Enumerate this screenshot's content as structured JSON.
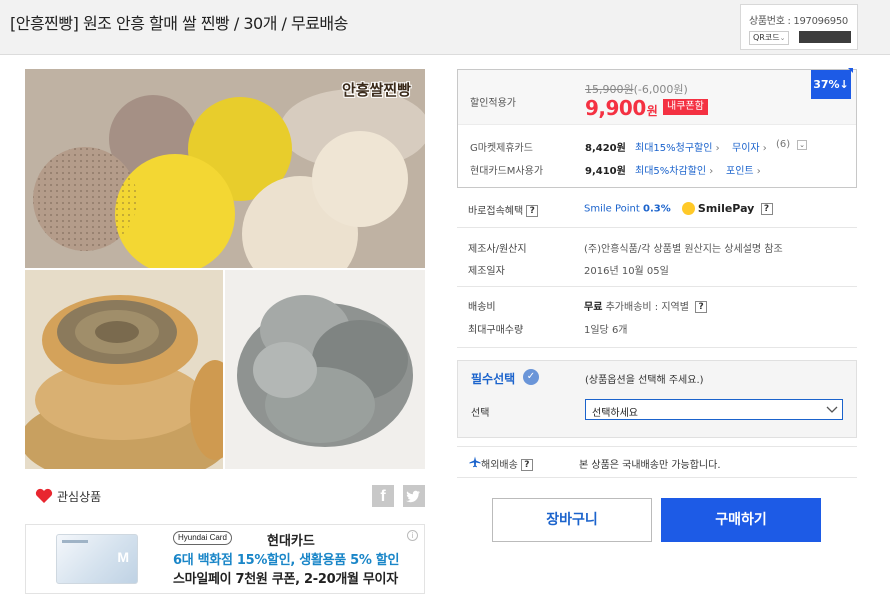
{
  "header": {
    "title": "[안흥찐빵] 원조 안흥 할매 쌀 찐빵 / 30개 / 무료배송",
    "product_no_label": "상품번호 : 197096950",
    "qr_label": "QR코드"
  },
  "gallery": {
    "image_caption": "안흥쌀찐빵"
  },
  "actions_left": {
    "wish_label": "관심상품",
    "facebook_glyph": "f"
  },
  "banner": {
    "card_brand_logo": "Hyundai Card",
    "card_name": "현대카드",
    "promo_line1": "6대 백화점 15%할인, 생활용품 5% 할인",
    "promo_line2": "스마일페이 7천원 쿠폰, 2-20개월 무이자",
    "card_mark": "M",
    "info_glyph": "i"
  },
  "price": {
    "label": "할인적용가",
    "original": "15,900원",
    "discount": "(-6,000원)",
    "sale": "9,900",
    "sale_unit": "원",
    "coupon_tag": "내쿠폰함",
    "discount_badge": "37%↓",
    "accent_color": "#f43142",
    "brand_blue": "#1d5be6"
  },
  "cards": [
    {
      "label": "G마켓제휴카드",
      "amount": "8,420원",
      "benefit": "최대15%청구할인",
      "chev1": "›",
      "installment": "무이자",
      "chev2": "›",
      "count": "(6)"
    },
    {
      "label": "현대카드M사용가",
      "amount": "9,410원",
      "benefit": "최대5%차감할인",
      "chev1": "›",
      "points": "포인트",
      "chev2": "›"
    }
  ],
  "benefit": {
    "label": "바로접속혜택",
    "smile_point": "Smile Point",
    "rate": "0.3%",
    "smilepay": "SmilePay"
  },
  "maker": {
    "label": "제조사/원산지",
    "value": "(주)안흥식품/각 상품별 원산지는 상세설명 참조",
    "date_label": "제조일자",
    "date_value": "2016년 10월 05일"
  },
  "shipping": {
    "label": "배송비",
    "free": "무료",
    "extra": "추가배송비 : 지역별",
    "max_label": "최대구매수량",
    "max_value": "1일당 6개"
  },
  "option": {
    "required_label": "필수선택",
    "hint": "(상품옵션을 선택해 주세요.)",
    "select_label": "선택",
    "select_value": "선택하세요"
  },
  "overseas": {
    "label": "해외배송",
    "text": "본 상품은 국내배송만 가능합니다."
  },
  "buttons": {
    "cart": "장바구니",
    "buy": "구매하기"
  },
  "icons": {
    "heart": "heart-icon",
    "facebook": "facebook-icon",
    "twitter": "twitter-icon",
    "help": "question-icon",
    "plane": "plane-icon",
    "check": "check-badge-icon",
    "chevron": "chevron-down-icon"
  },
  "glyphs": {
    "question": "?",
    "down": "⌄",
    "check": "✓"
  }
}
